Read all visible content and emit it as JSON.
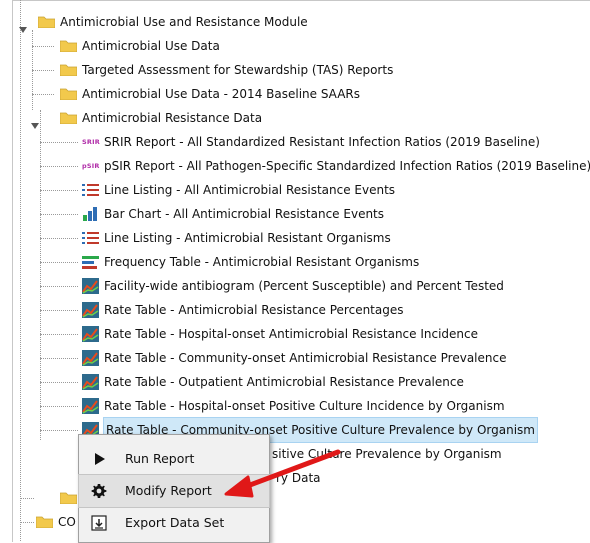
{
  "tree": {
    "module_label": "Antimicrobial Use and Resistance Module",
    "folders": [
      {
        "label": "Antimicrobial Use Data"
      },
      {
        "label": "Targeted Assessment for Stewardship (TAS) Reports"
      },
      {
        "label": "Antimicrobial Use Data - 2014 Baseline SAARs"
      },
      {
        "label": "Antimicrobial Resistance Data"
      }
    ],
    "reports": [
      {
        "label": "SRIR Report - All Standardized Resistant Infection Ratios (2019 Baseline)",
        "badge": "SRIR"
      },
      {
        "label": "pSIR Report - All Pathogen-Specific Standardized Infection Ratios (2019 Baseline)",
        "badge": "pSIR"
      },
      {
        "label": "Line Listing - All Antimicrobial Resistance Events"
      },
      {
        "label": "Bar Chart - All Antimicrobial Resistance Events"
      },
      {
        "label": "Line Listing - Antimicrobial Resistant Organisms"
      },
      {
        "label": "Frequency Table - Antimicrobial Resistant Organisms"
      },
      {
        "label": "Facility-wide antibiogram (Percent Susceptible) and Percent Tested"
      },
      {
        "label": "Rate Table - Antimicrobial Resistance Percentages"
      },
      {
        "label": "Rate Table - Hospital-onset Antimicrobial Resistance Incidence"
      },
      {
        "label": "Rate Table - Community-onset Antimicrobial Resistance Prevalence"
      },
      {
        "label": "Rate Table - Outpatient Antimicrobial Resistance Prevalence"
      },
      {
        "label": "Rate Table - Hospital-onset Positive Culture Incidence by Organism"
      },
      {
        "label": "Rate Table - Community-onset Positive Culture Prevalence by Organism"
      }
    ],
    "partial_rows": [
      {
        "label": "sitive Culture Prevalence by Organism"
      },
      {
        "label": "ry Data"
      }
    ],
    "bottom_folder_label": "CO"
  },
  "context_menu": {
    "items": [
      {
        "label": "Run Report",
        "icon": "play-icon"
      },
      {
        "label": "Modify Report",
        "icon": "gear-icon"
      },
      {
        "label": "Export Data Set",
        "icon": "export-icon"
      }
    ]
  },
  "colors": {
    "folder": "#f2c94c",
    "selection": "#cfe8f8",
    "arrow": "#e01818"
  }
}
